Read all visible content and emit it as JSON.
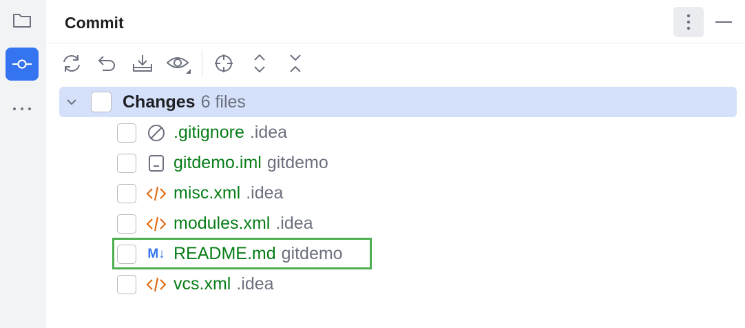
{
  "panel": {
    "title": "Commit"
  },
  "icons": {
    "sidebar": [
      "folder-icon",
      "commit-icon",
      "more-horizontal-icon"
    ],
    "toolbar": [
      "refresh-icon",
      "rollback-icon",
      "shelve-icon",
      "preview-icon",
      "locate-icon",
      "expand-all-icon",
      "collapse-all-icon"
    ]
  },
  "changes": {
    "label": "Changes",
    "count": "6 files",
    "files": [
      {
        "name": ".gitignore",
        "dir": ".idea",
        "icon": "ignore-icon"
      },
      {
        "name": "gitdemo.iml",
        "dir": "gitdemo",
        "icon": "module-file-icon"
      },
      {
        "name": "misc.xml",
        "dir": ".idea",
        "icon": "xml-icon"
      },
      {
        "name": "modules.xml",
        "dir": ".idea",
        "icon": "xml-icon"
      },
      {
        "name": "README.md",
        "dir": "gitdemo",
        "icon": "markdown-icon",
        "glyph": "M↓"
      },
      {
        "name": "vcs.xml",
        "dir": ".idea",
        "icon": "xml-icon"
      }
    ]
  },
  "colors": {
    "accent": "#3574f0",
    "file_modified": "#067d17",
    "selection": "#d5e1fb",
    "highlight_box": "#4caf50",
    "xml_icon": "#e06c16"
  }
}
